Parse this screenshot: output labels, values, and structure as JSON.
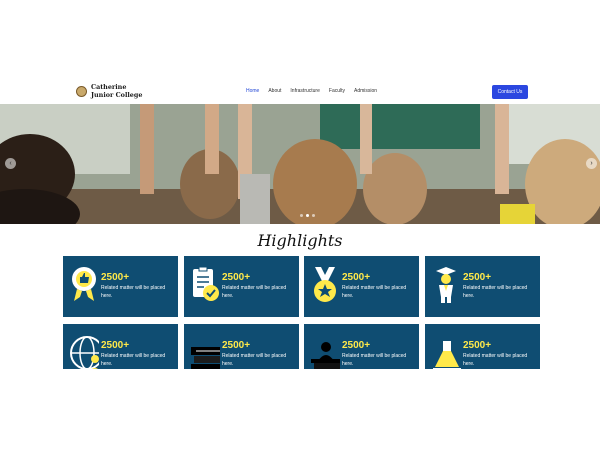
{
  "brand": {
    "name_line1": "Catherine",
    "name_line2": "Junior College"
  },
  "nav": {
    "items": [
      {
        "label": "Home",
        "active": true
      },
      {
        "label": "About"
      },
      {
        "label": "Infrastructure"
      },
      {
        "label": "Faculty"
      },
      {
        "label": "Admission"
      }
    ]
  },
  "contact_button": "Contact Us",
  "hero": {
    "slides_count": 3,
    "active_slide": 2
  },
  "section": {
    "title": "Highlights"
  },
  "highlights": [
    {
      "value": "2500+",
      "text": "Related matter will be placed here.",
      "icon": "award-thumb-icon"
    },
    {
      "value": "2500+",
      "text": "Related matter will be placed here.",
      "icon": "clipboard-check-icon"
    },
    {
      "value": "2500+",
      "text": "Related matter will be placed here.",
      "icon": "medal-star-icon"
    },
    {
      "value": "2500+",
      "text": "Related matter will be placed here.",
      "icon": "graduate-icon"
    },
    {
      "value": "2500+",
      "text": "Related matter will be placed here.",
      "icon": "globe-person-icon"
    },
    {
      "value": "2500+",
      "text": "Related matter will be placed here.",
      "icon": "books-icon"
    },
    {
      "value": "2500+",
      "text": "Related matter will be placed here.",
      "icon": "teacher-desk-icon"
    },
    {
      "value": "2500+",
      "text": "Related matter will be placed here.",
      "icon": "flask-icon"
    }
  ],
  "colors": {
    "card_bg": "#0f4d72",
    "accent_yellow": "#ffe94a",
    "button_blue": "#2b47e0"
  }
}
